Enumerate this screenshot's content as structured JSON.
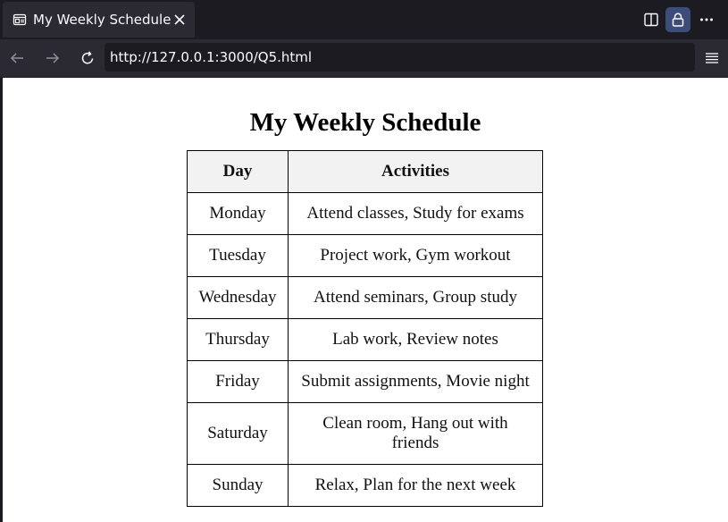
{
  "browser": {
    "tab": {
      "title": "My Weekly Schedule",
      "icon": "page-icon"
    },
    "url": "http://127.0.0.1:3000/Q5.html",
    "toolbar_icons": [
      "sidebar-icon",
      "lock-icon",
      "more-icon",
      "back-arrow-icon",
      "forward-arrow-icon",
      "reload-icon",
      "menu-icon"
    ],
    "colors": {
      "chrome_dark": "#1c1b22",
      "chrome": "#2b2a33",
      "lock_highlight": "#3c4d7a"
    }
  },
  "page": {
    "title": "My Weekly Schedule",
    "table": {
      "headers": [
        "Day",
        "Activities"
      ],
      "rows": [
        {
          "day": "Monday",
          "activities": "Attend classes, Study for exams"
        },
        {
          "day": "Tuesday",
          "activities": "Project work, Gym workout"
        },
        {
          "day": "Wednesday",
          "activities": "Attend seminars, Group study"
        },
        {
          "day": "Thursday",
          "activities": "Lab work, Review notes"
        },
        {
          "day": "Friday",
          "activities": "Submit assignments, Movie night"
        },
        {
          "day": "Saturday",
          "activities": "Clean room, Hang out with friends"
        },
        {
          "day": "Sunday",
          "activities": "Relax, Plan for the next week"
        }
      ]
    }
  }
}
